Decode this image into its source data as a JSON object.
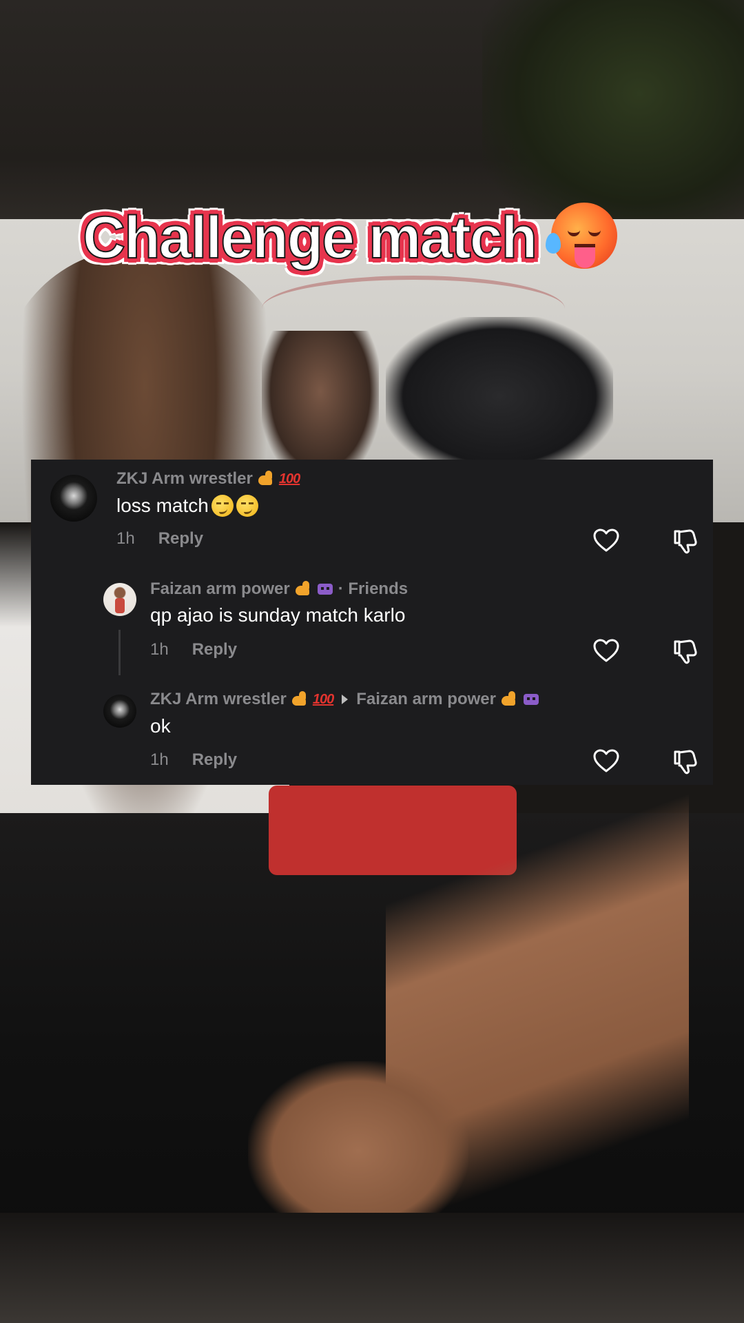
{
  "overlay": {
    "caption": "Challenge match"
  },
  "comments": [
    {
      "username": "ZKJ Arm wrestler",
      "username_emojis": [
        "muscle",
        "100"
      ],
      "text": "loss match",
      "text_emojis": [
        "smirk",
        "smirk"
      ],
      "time": "1h",
      "reply_label": "Reply"
    },
    {
      "username": "Faizan arm power",
      "username_emojis": [
        "muscle",
        "alien"
      ],
      "tag": "· Friends",
      "text": "qp ajao is sunday match karlo",
      "time": "1h",
      "reply_label": "Reply"
    },
    {
      "username": "ZKJ Arm wrestler",
      "username_emojis": [
        "muscle",
        "100"
      ],
      "reply_to": "Faizan arm power",
      "reply_to_emojis": [
        "muscle",
        "alien"
      ],
      "text": "ok",
      "time": "1h",
      "reply_label": "Reply"
    }
  ],
  "icons": {
    "like": "heart-outline-icon",
    "dislike": "thumbs-down-outline-icon"
  },
  "colors": {
    "card_bg": "#1c1c1e",
    "muted_text": "#8a8a8d",
    "caption_outline": "#e7344d"
  }
}
